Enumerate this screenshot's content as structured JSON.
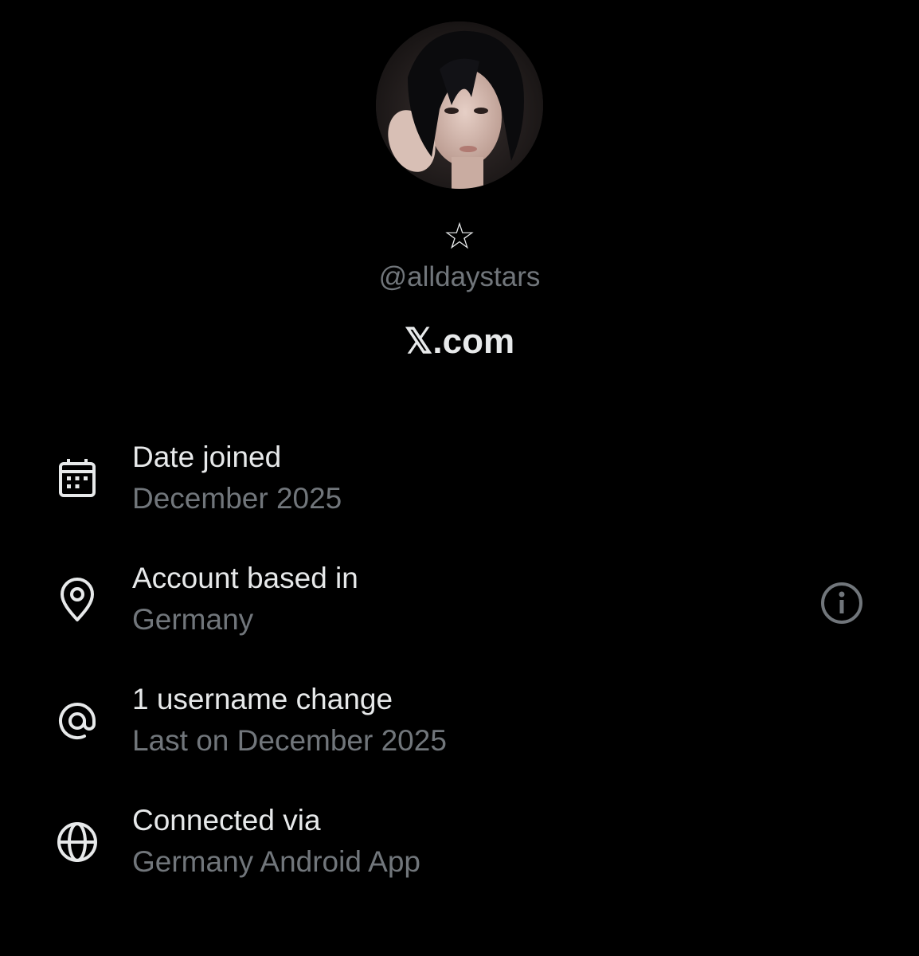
{
  "profile": {
    "display_name": "☆",
    "handle": "@alldaystars",
    "brand": "𝕏.com"
  },
  "details": [
    {
      "icon": "calendar-icon",
      "title": "Date joined",
      "subtitle": "December 2025"
    },
    {
      "icon": "location-pin-icon",
      "title": "Account based in",
      "subtitle": "Germany"
    },
    {
      "icon": "at-sign-icon",
      "title": "1 username change",
      "subtitle": "Last on December 2025"
    },
    {
      "icon": "globe-icon",
      "title": "Connected via",
      "subtitle": "Germany Android App"
    }
  ],
  "colors": {
    "background": "#000000",
    "primary_text": "#e7e9ea",
    "secondary_text": "#71767b"
  }
}
